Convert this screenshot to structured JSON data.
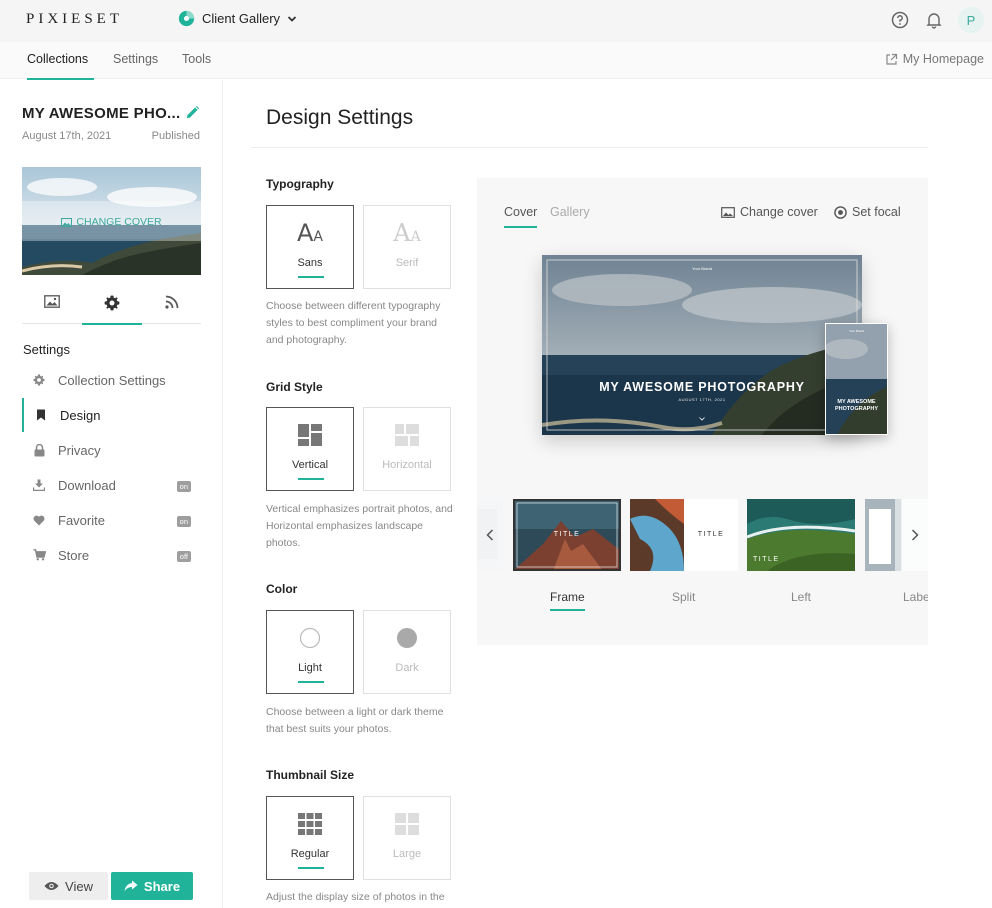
{
  "topbar": {
    "logo": "PIXIESET",
    "app_name": "Client Gallery",
    "avatar_letter": "P"
  },
  "nav": {
    "tabs": [
      {
        "label": "Collections",
        "active": true
      },
      {
        "label": "Settings",
        "active": false
      },
      {
        "label": "Tools",
        "active": false
      }
    ],
    "homepage_label": "My Homepage"
  },
  "collection": {
    "title": "MY AWESOME PHO...",
    "date": "August 17th, 2021",
    "status": "Published",
    "change_cover_label": "CHANGE COVER"
  },
  "sidebar": {
    "tab_icons": [
      "image-icon",
      "gear-icon",
      "rss-icon"
    ],
    "settings_heading": "Settings",
    "items": [
      {
        "label": "Collection Settings",
        "icon": "gear-icon",
        "badge": ""
      },
      {
        "label": "Design",
        "icon": "bookmark-icon",
        "badge": "",
        "active": true
      },
      {
        "label": "Privacy",
        "icon": "lock-icon",
        "badge": ""
      },
      {
        "label": "Download",
        "icon": "download-icon",
        "badge": "on"
      },
      {
        "label": "Favorite",
        "icon": "heart-icon",
        "badge": "on"
      },
      {
        "label": "Store",
        "icon": "cart-icon",
        "badge": "off"
      }
    ],
    "view_label": "View",
    "share_label": "Share"
  },
  "main": {
    "title": "Design Settings",
    "typography": {
      "title": "Typography",
      "options": [
        "Sans",
        "Serif"
      ],
      "selected": "Sans",
      "glyph": "A",
      "glyph_small": "A",
      "desc": "Choose between different typography styles to best compliment your brand and photography."
    },
    "grid_style": {
      "title": "Grid Style",
      "options": [
        "Vertical",
        "Horizontal"
      ],
      "selected": "Vertical",
      "desc": "Vertical emphasizes portrait photos, and Horizontal emphasizes landscape photos."
    },
    "color": {
      "title": "Color",
      "options": [
        "Light",
        "Dark"
      ],
      "selected": "Light",
      "desc": "Choose between a light or dark theme that best suits your photos."
    },
    "thumbnail_size": {
      "title": "Thumbnail Size",
      "options": [
        "Regular",
        "Large"
      ],
      "selected": "Regular",
      "desc": "Adjust the display size of photos in the"
    }
  },
  "preview": {
    "tabs": [
      {
        "label": "Cover",
        "active": true
      },
      {
        "label": "Gallery",
        "active": false
      }
    ],
    "change_cover_label": "Change cover",
    "set_focal_label": "Set focal",
    "desktop_brand": "Your Brand",
    "desktop_title": "MY AWESOME PHOTOGRAPHY",
    "desktop_date": "AUGUST 17TH, 2021",
    "phone_brand": "Your Brand",
    "phone_title": "MY AWESOME PHOTOGRAPHY",
    "thumb_title": "TITLE",
    "layouts": [
      {
        "label": "Frame",
        "active": true
      },
      {
        "label": "Split",
        "active": false
      },
      {
        "label": "Left",
        "active": false
      },
      {
        "label": "Label",
        "active": false
      }
    ]
  },
  "colors": {
    "accent": "#20b39a",
    "accent_text": "#3aa99a"
  }
}
